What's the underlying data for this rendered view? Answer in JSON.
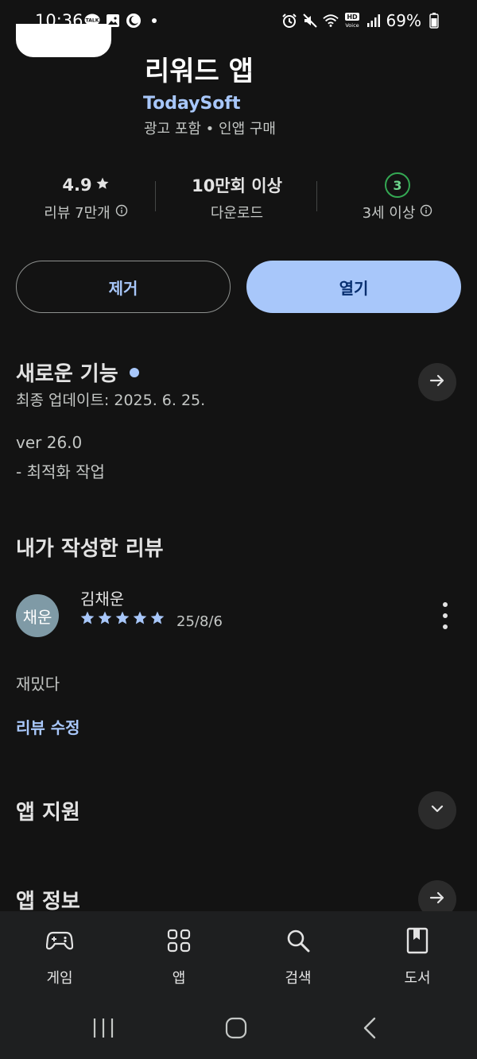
{
  "status_bar": {
    "time": "10:36",
    "talk_badge": "TALK",
    "hd_badge": "HD",
    "voice_badge": "Voice",
    "battery": "69%"
  },
  "header": {
    "app_title": "리워드 앱",
    "developer": "TodaySoft",
    "ads_note": "광고 포함 • 인앱 구매"
  },
  "stats": {
    "rating_value": "4.9",
    "rating_label": "리뷰 7만개",
    "downloads_value": "10만회 이상",
    "downloads_label": "다운로드",
    "age_value": "3",
    "age_label": "3세 이상"
  },
  "buttons": {
    "uninstall": "제거",
    "open": "열기"
  },
  "whats_new": {
    "title": "새로운 기능",
    "last_updated": "최종 업데이트: 2025. 6. 25.",
    "version": "ver 26.0",
    "notes": "- 최적화 작업"
  },
  "my_review": {
    "title": "내가 작성한 리뷰",
    "avatar_text": "채운",
    "reviewer": "김채운",
    "stars": 5,
    "date": "25/8/6",
    "body": "재밌다",
    "edit_label": "리뷰 수정"
  },
  "app_support": {
    "title": "앱 지원"
  },
  "about_app": {
    "title": "앱 정보"
  },
  "bottom_nav": {
    "games": "게임",
    "apps": "앱",
    "search": "검색",
    "books": "도서"
  },
  "colors": {
    "background": "#131313",
    "accent": "#a8c7fa",
    "age_badge": "#34a853",
    "avatar": "#7f9aa6"
  }
}
